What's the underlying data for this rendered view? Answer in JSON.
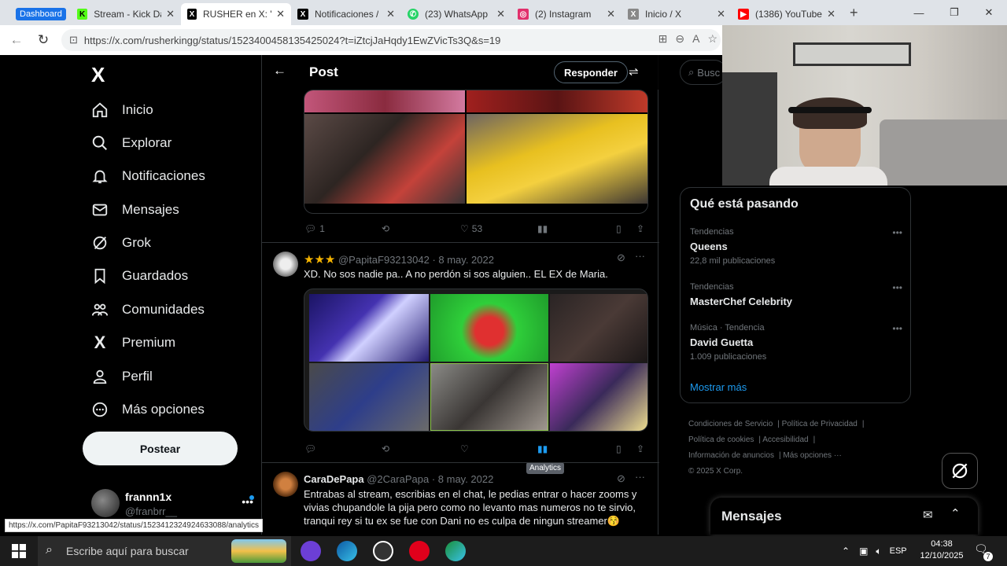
{
  "browser": {
    "tabs": [
      {
        "label": "Dashboard",
        "icon": "dashboard-group-icon",
        "color": "#1a73e8"
      },
      {
        "label": "Stream - Kick Da",
        "icon": "kick-icon",
        "color": "#53fc18"
      },
      {
        "label": "RUSHER en X: \"@",
        "icon": "x-icon",
        "color": "#000000",
        "active": true
      },
      {
        "label": "Notificaciones /",
        "icon": "x-icon",
        "color": "#000000"
      },
      {
        "label": "(23) WhatsApp",
        "icon": "whatsapp-icon",
        "color": "#25d366"
      },
      {
        "label": "(2) Instagram",
        "icon": "instagram-icon",
        "color": "#e1306c"
      },
      {
        "label": "Inicio / X",
        "icon": "x-icon",
        "color": "#555555"
      },
      {
        "label": "(1386) YouTube",
        "icon": "youtube-icon",
        "color": "#ff0000"
      }
    ],
    "new_tab": "+",
    "url": "https://x.com/rusherkingg/status/1523400458135425024?t=iZtcjJaHqdy1EwZVicTs3Q&s=19",
    "status_url": "https://x.com/PapitaF93213042/status/1523412324924633088/analytics"
  },
  "x": {
    "logo": "X",
    "nav": [
      {
        "label": "Inicio",
        "icon": "home-icon"
      },
      {
        "label": "Explorar",
        "icon": "search-icon"
      },
      {
        "label": "Notificaciones",
        "icon": "bell-icon"
      },
      {
        "label": "Mensajes",
        "icon": "mail-icon"
      },
      {
        "label": "Grok",
        "icon": "grok-icon"
      },
      {
        "label": "Guardados",
        "icon": "bookmark-icon"
      },
      {
        "label": "Comunidades",
        "icon": "communities-icon"
      },
      {
        "label": "Premium",
        "icon": "x-premium-icon"
      },
      {
        "label": "Perfil",
        "icon": "person-icon"
      },
      {
        "label": "Más opciones",
        "icon": "more-circle-icon"
      }
    ],
    "post_button": "Postear",
    "account": {
      "name": "frannn1x",
      "handle": "@franbrr__"
    },
    "header": {
      "title": "Post",
      "reply": "Responder"
    },
    "tweet1": {
      "replies": "1",
      "likes": "53"
    },
    "tweet2": {
      "stars": "★★★",
      "handle": "@PapitaF93213042",
      "date": "· 8 may. 2022",
      "text": "XD. No sos nadie pa.. A no perdón si sos alguien.. EL EX de Maria.",
      "tooltip": "Analytics"
    },
    "tweet3": {
      "name": "CaraDePapa",
      "handle": "@2CaraPapa",
      "date": "· 8 may. 2022",
      "text": "Entrabas al stream, escribias en el chat, le pedias entrar o hacer zooms y vivias chupandole la pija pero como no levanto mas numeros no te sirvio, tranqui rey si tu ex se fue con Dani no es culpa de ningun streamer😚"
    },
    "search_placeholder": "Busc",
    "trends": {
      "title": "Qué está pasando",
      "items": [
        {
          "category": "Tendencias",
          "name": "Queens",
          "count": "22,8 mil publicaciones"
        },
        {
          "category": "Tendencias",
          "name": "MasterChef Celebrity",
          "count": ""
        },
        {
          "category": "Música · Tendencia",
          "name": "David Guetta",
          "count": "1.009 publicaciones"
        }
      ],
      "show_more": "Mostrar más"
    },
    "footer": [
      "Condiciones de Servicio",
      "Política de Privacidad",
      "Política de cookies",
      "Accesibilidad",
      "Información de anuncios",
      "Más opciones ···",
      "© 2025 X Corp."
    ],
    "messages": "Mensajes"
  },
  "taskbar": {
    "search": "Escribe aquí para buscar",
    "lang": "ESP",
    "time": "04:38",
    "date": "12/10/2025",
    "notif_count": "7"
  }
}
